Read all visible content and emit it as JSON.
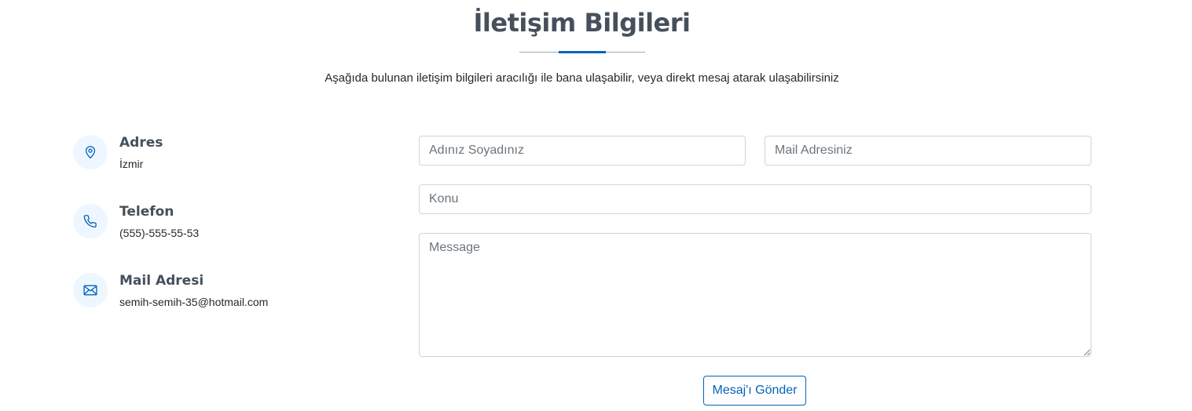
{
  "section": {
    "title": "İletişim Bilgileri",
    "description": "Aşağıda bulunan iletişim bilgileri aracılığı ile bana ulaşabilir, veya direkt mesaj atarak ulaşabilirsiniz"
  },
  "info": {
    "address": {
      "icon": "map-pin-icon",
      "title": "Adres",
      "value": "İzmir"
    },
    "phone": {
      "icon": "phone-icon",
      "title": "Telefon",
      "value": "(555)-555-55-53"
    },
    "email": {
      "icon": "envelope-icon",
      "title": "Mail Adresi",
      "value": "semih-semih-35@hotmail.com"
    }
  },
  "form": {
    "name_placeholder": "Adınız Soyadınız",
    "email_placeholder": "Mail Adresiniz",
    "subject_placeholder": "Konu",
    "message_placeholder": "Message",
    "submit_label": "Mesaj'ı Gönder"
  },
  "colors": {
    "accent": "#0563bb",
    "icon_background": "#eef7ff",
    "heading": "#45505b"
  }
}
